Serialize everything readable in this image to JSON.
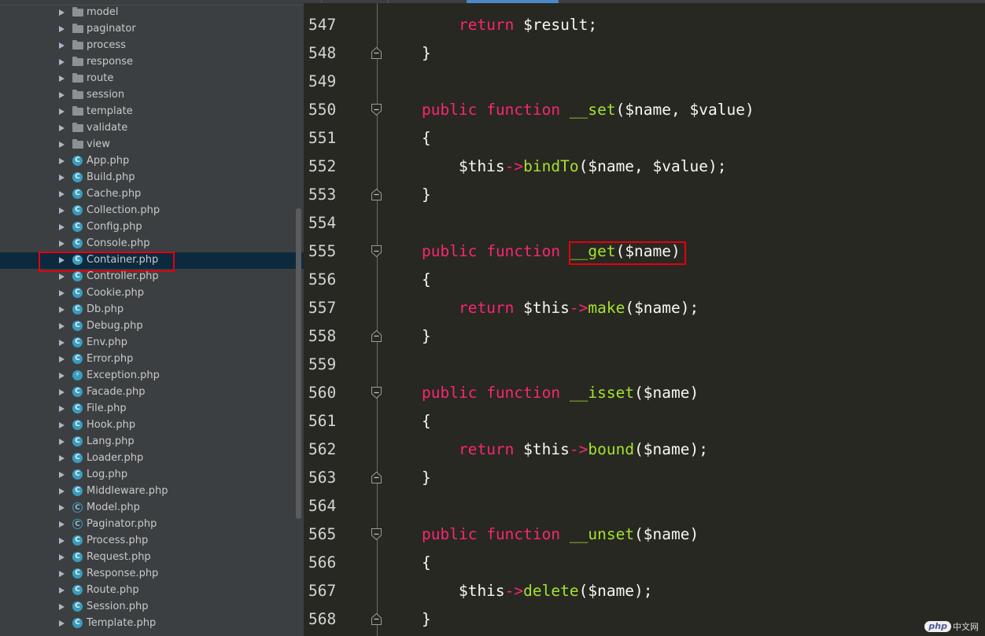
{
  "project_tree": {
    "folders": [
      "model",
      "paginator",
      "process",
      "response",
      "route",
      "session",
      "template",
      "validate",
      "view"
    ],
    "files": [
      {
        "name": "App.php",
        "icon": "class-icon"
      },
      {
        "name": "Build.php",
        "icon": "class-icon"
      },
      {
        "name": "Cache.php",
        "icon": "class-icon"
      },
      {
        "name": "Collection.php",
        "icon": "class-icon"
      },
      {
        "name": "Config.php",
        "icon": "class-icon"
      },
      {
        "name": "Console.php",
        "icon": "class-icon"
      },
      {
        "name": "Container.php",
        "icon": "class-icon",
        "selected": true,
        "highlighted": true
      },
      {
        "name": "Controller.php",
        "icon": "class-icon"
      },
      {
        "name": "Cookie.php",
        "icon": "class-icon"
      },
      {
        "name": "Db.php",
        "icon": "class-icon"
      },
      {
        "name": "Debug.php",
        "icon": "class-icon"
      },
      {
        "name": "Env.php",
        "icon": "class-icon"
      },
      {
        "name": "Error.php",
        "icon": "class-icon"
      },
      {
        "name": "Exception.php",
        "icon": "exception-class-icon"
      },
      {
        "name": "Facade.php",
        "icon": "class-icon"
      },
      {
        "name": "File.php",
        "icon": "class-icon"
      },
      {
        "name": "Hook.php",
        "icon": "class-icon"
      },
      {
        "name": "Lang.php",
        "icon": "class-icon"
      },
      {
        "name": "Loader.php",
        "icon": "class-icon"
      },
      {
        "name": "Log.php",
        "icon": "class-icon"
      },
      {
        "name": "Middleware.php",
        "icon": "class-icon"
      },
      {
        "name": "Model.php",
        "icon": "abstract-class-icon"
      },
      {
        "name": "Paginator.php",
        "icon": "abstract-class-icon"
      },
      {
        "name": "Process.php",
        "icon": "class-icon"
      },
      {
        "name": "Request.php",
        "icon": "class-icon"
      },
      {
        "name": "Response.php",
        "icon": "class-icon"
      },
      {
        "name": "Route.php",
        "icon": "class-icon"
      },
      {
        "name": "Session.php",
        "icon": "class-icon"
      },
      {
        "name": "Template.php",
        "icon": "class-icon"
      }
    ]
  },
  "editor": {
    "lines": [
      {
        "n": "547",
        "fold": "",
        "tokens": [
          [
            "    ",
            ""
          ],
          [
            "return",
            "kw"
          ],
          [
            " $result;",
            ""
          ]
        ]
      },
      {
        "n": "548",
        "fold": "end",
        "tokens": [
          [
            "}",
            ""
          ]
        ]
      },
      {
        "n": "549",
        "fold": "",
        "tokens": []
      },
      {
        "n": "550",
        "fold": "start",
        "tokens": [
          [
            "public",
            "kw"
          ],
          [
            " ",
            ""
          ],
          [
            "function",
            "kw"
          ],
          [
            " ",
            ""
          ],
          [
            "__set",
            "fn"
          ],
          [
            "($name, $value)",
            ""
          ]
        ]
      },
      {
        "n": "551",
        "fold": "",
        "tokens": [
          [
            "{",
            ""
          ]
        ]
      },
      {
        "n": "552",
        "fold": "",
        "tokens": [
          [
            "    $this",
            ""
          ],
          [
            "->",
            "kw"
          ],
          [
            "bindTo",
            "fn"
          ],
          [
            "($name, $value);",
            ""
          ]
        ]
      },
      {
        "n": "553",
        "fold": "end",
        "tokens": [
          [
            "}",
            ""
          ]
        ]
      },
      {
        "n": "554",
        "fold": "",
        "tokens": []
      },
      {
        "n": "555",
        "fold": "start",
        "tokens": [
          [
            "public",
            "kw"
          ],
          [
            " ",
            ""
          ],
          [
            "function",
            "kw"
          ],
          [
            " ",
            ""
          ],
          [
            "__get",
            "fn"
          ],
          [
            "($name)",
            ""
          ]
        ]
      },
      {
        "n": "556",
        "fold": "",
        "tokens": [
          [
            "{",
            ""
          ]
        ]
      },
      {
        "n": "557",
        "fold": "",
        "tokens": [
          [
            "    ",
            ""
          ],
          [
            "return",
            "kw"
          ],
          [
            " $this",
            ""
          ],
          [
            "->",
            "kw"
          ],
          [
            "make",
            "fn"
          ],
          [
            "($name);",
            ""
          ]
        ]
      },
      {
        "n": "558",
        "fold": "end",
        "tokens": [
          [
            "}",
            ""
          ]
        ]
      },
      {
        "n": "559",
        "fold": "",
        "tokens": []
      },
      {
        "n": "560",
        "fold": "start",
        "tokens": [
          [
            "public",
            "kw"
          ],
          [
            " ",
            ""
          ],
          [
            "function",
            "kw"
          ],
          [
            " ",
            ""
          ],
          [
            "__isset",
            "fn"
          ],
          [
            "($name)",
            ""
          ]
        ]
      },
      {
        "n": "561",
        "fold": "",
        "tokens": [
          [
            "{",
            ""
          ]
        ]
      },
      {
        "n": "562",
        "fold": "",
        "tokens": [
          [
            "    ",
            ""
          ],
          [
            "return",
            "kw"
          ],
          [
            " $this",
            ""
          ],
          [
            "->",
            "kw"
          ],
          [
            "bound",
            "fn"
          ],
          [
            "($name);",
            ""
          ]
        ]
      },
      {
        "n": "563",
        "fold": "end",
        "tokens": [
          [
            "}",
            ""
          ]
        ]
      },
      {
        "n": "564",
        "fold": "",
        "tokens": []
      },
      {
        "n": "565",
        "fold": "start",
        "tokens": [
          [
            "public",
            "kw"
          ],
          [
            " ",
            ""
          ],
          [
            "function",
            "kw"
          ],
          [
            " ",
            ""
          ],
          [
            "__unset",
            "fn"
          ],
          [
            "($name)",
            ""
          ]
        ]
      },
      {
        "n": "566",
        "fold": "",
        "tokens": [
          [
            "{",
            ""
          ]
        ]
      },
      {
        "n": "567",
        "fold": "",
        "tokens": [
          [
            "    $this",
            ""
          ],
          [
            "->",
            "kw"
          ],
          [
            "delete",
            "fn"
          ],
          [
            "($name);",
            ""
          ]
        ]
      },
      {
        "n": "568",
        "fold": "end",
        "tokens": [
          [
            "}",
            ""
          ]
        ]
      }
    ]
  },
  "watermark": {
    "badge": "php",
    "text": "中文网"
  },
  "colors": {
    "keyword": "#f92672",
    "function_name": "#a6e22e",
    "default_text": "#f8f8f2",
    "editor_background": "#272822",
    "sidebar_background": "#3c3f41",
    "selection_background": "#0d293e",
    "highlight_box": "#e3000f"
  }
}
